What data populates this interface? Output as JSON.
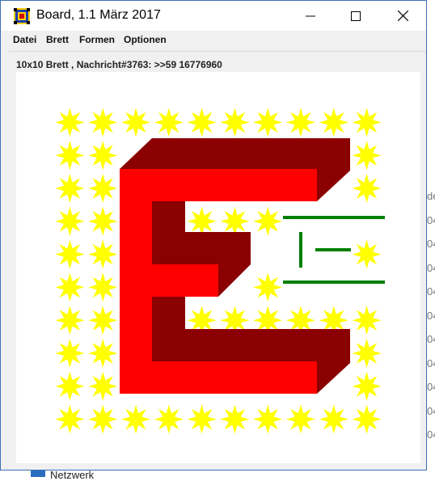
{
  "window": {
    "title": "Board, 1.1 März 2017",
    "controls": {
      "minimize_icon": "minimize-icon",
      "maximize_icon": "maximize-icon",
      "close_icon": "close-icon"
    }
  },
  "menu": {
    "items": [
      "Datei",
      "Brett",
      "Formen",
      "Optionen"
    ]
  },
  "status": "10x10 Brett , Nachricht#3763: >>59 16776960",
  "board": {
    "size": "10x10",
    "colors": {
      "star": "#ffff00",
      "front": "#ff0000",
      "side": "#8b0000",
      "line": "#008000",
      "background": "#ffffff"
    }
  },
  "background_app": {
    "list_fragments": [
      "de",
      "04",
      "04",
      "04",
      "04",
      "04",
      "04",
      "04",
      "04",
      "04",
      "04"
    ],
    "bottom_label": "Netzwerk"
  }
}
